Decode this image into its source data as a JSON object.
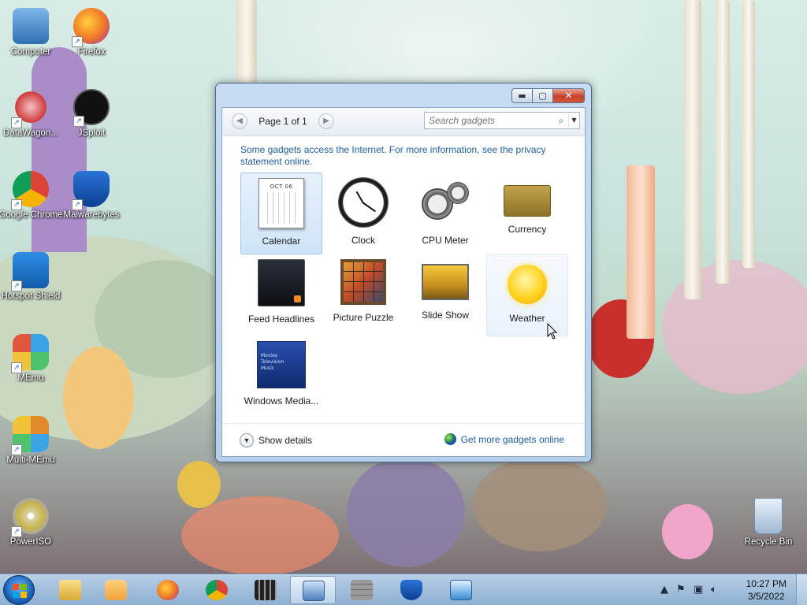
{
  "desktop": {
    "icons": [
      {
        "label": "Computer",
        "icon": "computer-icon",
        "color": "#4a90d0"
      },
      {
        "label": "Firefox",
        "icon": "firefox-icon",
        "color": "#f0742a"
      },
      {
        "label": "DataWagon...",
        "icon": "datawagon-icon",
        "color": "#d03a3a"
      },
      {
        "label": "JSploit",
        "icon": "jsploit-icon",
        "color": "#111111"
      },
      {
        "label": "Google Chrome",
        "icon": "chrome-icon",
        "color": "#2f9e44"
      },
      {
        "label": "Malwarebytes",
        "icon": "malwarebytes-icon",
        "color": "#1f5fc0"
      },
      {
        "label": "Hotspot Shield",
        "icon": "hotspot-shield-icon",
        "color": "#1e7dd7"
      },
      {
        "label": "MEmu",
        "icon": "memu-icon",
        "color": "#3aa4e6"
      },
      {
        "label": "Multi-MEmu",
        "icon": "multi-memu-icon",
        "color": "#e08a2b"
      },
      {
        "label": "PowerISO",
        "icon": "poweriso-icon",
        "color": "#c8b44a"
      },
      {
        "label": "Recycle Bin",
        "icon": "recycle-bin-icon",
        "color": "#9fb9d4"
      }
    ]
  },
  "window": {
    "title": "",
    "controls": {
      "minimize": "▬",
      "maximize": "▢",
      "close": "✕"
    },
    "pager": {
      "label": "Page 1 of 1",
      "prev": "◀",
      "next": "▶"
    },
    "search": {
      "placeholder": "Search gadgets",
      "icon": "⌕",
      "dropdown": "▼"
    },
    "info_text": "Some gadgets access the Internet.  For more information, see the privacy statement online.",
    "gadgets": [
      {
        "label": "Calendar",
        "icon": "calendar-icon",
        "state": "selected",
        "month": "OCT 06"
      },
      {
        "label": "Clock",
        "icon": "clock-icon",
        "state": "normal"
      },
      {
        "label": "CPU Meter",
        "icon": "cpu-meter-icon",
        "state": "normal"
      },
      {
        "label": "Currency",
        "icon": "currency-icon",
        "state": "normal"
      },
      {
        "label": "Feed Headlines",
        "icon": "feed-headlines-icon",
        "state": "normal"
      },
      {
        "label": "Picture Puzzle",
        "icon": "picture-puzzle-icon",
        "state": "normal"
      },
      {
        "label": "Slide Show",
        "icon": "slide-show-icon",
        "state": "normal"
      },
      {
        "label": "Weather",
        "icon": "weather-icon",
        "state": "hover"
      },
      {
        "label": "Windows Media...",
        "icon": "windows-media-center-icon",
        "state": "normal",
        "menu": [
          "Movies",
          "Television",
          "Music"
        ]
      }
    ],
    "footer": {
      "show_details": "Show details",
      "more_gadgets": "Get more gadgets online"
    }
  },
  "taskbar": {
    "apps": [
      {
        "icon": "explorer-icon",
        "color": "#e8c14a",
        "active": false
      },
      {
        "icon": "media-player-icon",
        "color": "#f0a23a",
        "active": false
      },
      {
        "icon": "firefox-icon",
        "color": "#f0742a",
        "active": false
      },
      {
        "icon": "chrome-icon",
        "color": "#2f9e44",
        "active": false
      },
      {
        "icon": "video-icon",
        "color": "#333333",
        "active": false
      },
      {
        "icon": "gadgets-icon",
        "color": "#4a7fbf",
        "active": true
      },
      {
        "icon": "wall-icon",
        "color": "#7a7a7a",
        "active": false
      },
      {
        "icon": "malwarebytes-icon",
        "color": "#1f5fc0",
        "active": false
      },
      {
        "icon": "remote-desktop-icon",
        "color": "#3a8ed6",
        "active": false
      }
    ],
    "tray": {
      "time": "10:27 PM",
      "date": "3/5/2022"
    }
  }
}
